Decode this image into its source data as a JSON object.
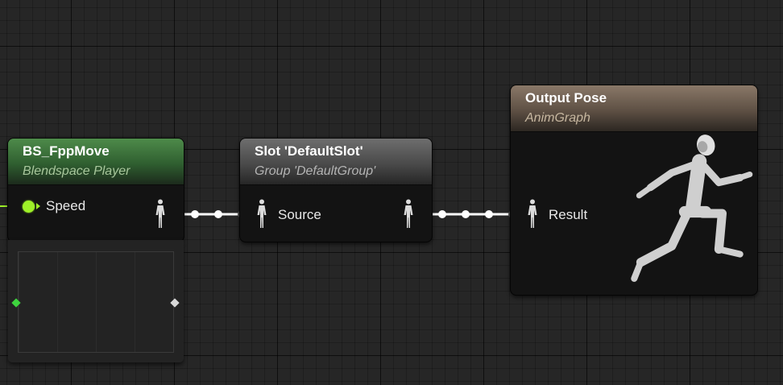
{
  "nodes": {
    "blendspace": {
      "title": "BS_FppMove",
      "subtitle": "Blendspace Player",
      "input_pin": "Speed",
      "header_color": "#3b7a3c",
      "subtitle_color": "#a8c79c"
    },
    "slot": {
      "title": "Slot 'DefaultSlot'",
      "subtitle": "Group 'DefaultGroup'",
      "input_pin": "Source",
      "header_color": "#5a5a5a",
      "subtitle_color": "#b0b0b0"
    },
    "output": {
      "title": "Output Pose",
      "subtitle": "AnimGraph",
      "input_pin": "Result",
      "header_color": "#7a6a5a",
      "subtitle_color": "#c7b7a0"
    }
  },
  "colors": {
    "speed_pin": "#9ef028",
    "pose_wire": "#ffffff",
    "canvas_background": "#262626"
  },
  "icons": {
    "pose_pin": "mannequin-pose-icon",
    "output_preview": "running-mannequin-icon"
  }
}
